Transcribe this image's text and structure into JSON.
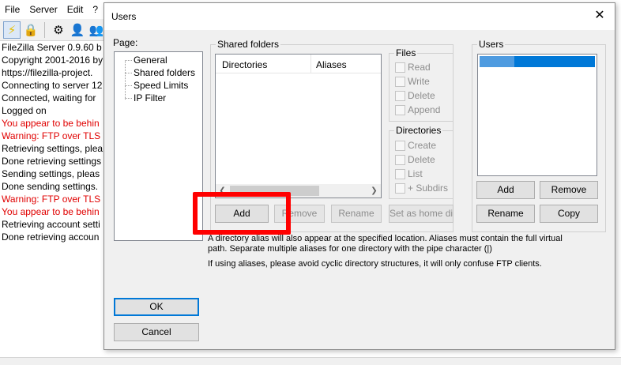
{
  "menu": [
    "File",
    "Server",
    "Edit",
    "?"
  ],
  "toolbar_icons": [
    "connect-icon",
    "lock-icon",
    "settings-icon",
    "users-icon",
    "groups-icon"
  ],
  "log_lines": [
    {
      "text": "FileZilla Server 0.9.60 b",
      "color": "#000000"
    },
    {
      "text": "Copyright 2001-2016 by",
      "color": "#000000"
    },
    {
      "text": "https://filezilla-project.",
      "color": "#000000"
    },
    {
      "text": "Connecting to server 12",
      "color": "#000000"
    },
    {
      "text": "Connected, waiting for",
      "color": "#000000"
    },
    {
      "text": "Logged on",
      "color": "#000000"
    },
    {
      "text": "You appear to be behin",
      "color": "#e00000"
    },
    {
      "text": "Warning: FTP over TLS",
      "color": "#e00000"
    },
    {
      "text": "Retrieving settings, plea",
      "color": "#000000"
    },
    {
      "text": "Done retrieving settings",
      "color": "#000000"
    },
    {
      "text": "Sending settings, pleas",
      "color": "#000000"
    },
    {
      "text": "Done sending settings.",
      "color": "#000000"
    },
    {
      "text": "Warning: FTP over TLS",
      "color": "#e00000"
    },
    {
      "text": "You appear to be behin",
      "color": "#e00000"
    },
    {
      "text": "Retrieving account setti",
      "color": "#000000"
    },
    {
      "text": "Done retrieving accoun",
      "color": "#000000"
    }
  ],
  "dialog": {
    "title": "Users",
    "page_label": "Page:",
    "pages": [
      "General",
      "Shared folders",
      "Speed Limits",
      "IP Filter"
    ],
    "selected_page": "Shared folders",
    "shared_folders": {
      "title": "Shared folders",
      "col_directories": "Directories",
      "col_aliases": "Aliases",
      "add": "Add",
      "remove": "Remove",
      "rename": "Rename",
      "set_home": "Set as home dir"
    },
    "files": {
      "title": "Files",
      "options": [
        "Read",
        "Write",
        "Delete",
        "Append"
      ]
    },
    "directories": {
      "title": "Directories",
      "options": [
        "Create",
        "Delete",
        "List",
        "+ Subdirs"
      ]
    },
    "users": {
      "title": "Users",
      "add": "Add",
      "remove": "Remove",
      "rename": "Rename",
      "copy": "Copy"
    },
    "note_line1": "A directory alias will also appear at the specified location. Aliases must contain the full virtual",
    "note_line2": "path. Separate multiple aliases for one directory with the pipe character (|)",
    "note_line3": "If using aliases, please avoid cyclic directory structures, it will only confuse FTP clients.",
    "ok": "OK",
    "cancel": "Cancel"
  },
  "colors": {
    "accent": "#0078d7",
    "highlight_box": "#ff0000",
    "log_warning": "#e00000"
  }
}
